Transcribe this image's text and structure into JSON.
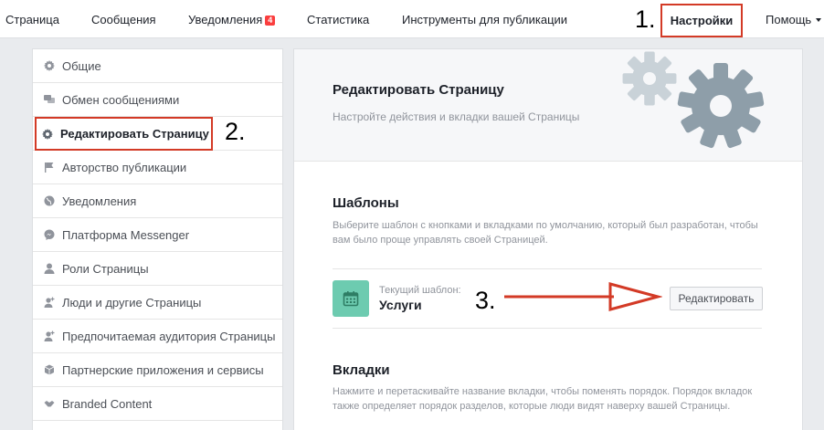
{
  "nav": {
    "page": "Страница",
    "messages": "Сообщения",
    "notifications": "Уведомления",
    "notifications_badge": "4",
    "insights": "Статистика",
    "publishing_tools": "Инструменты для публикации",
    "settings": "Настройки",
    "help": "Помощь"
  },
  "annotations": {
    "one": "1.",
    "two": "2.",
    "three": "3."
  },
  "sidebar": {
    "items": [
      {
        "label": "Общие",
        "icon": "gear-icon"
      },
      {
        "label": "Обмен сообщениями",
        "icon": "chat-icon"
      },
      {
        "label": "Редактировать Страницу",
        "icon": "gear-icon",
        "active": true
      },
      {
        "label": "Авторство публикации",
        "icon": "flag-icon"
      },
      {
        "label": "Уведомления",
        "icon": "globe-icon"
      },
      {
        "label": "Платформа Messenger",
        "icon": "messenger-icon"
      },
      {
        "label": "Роли Страницы",
        "icon": "person-icon"
      },
      {
        "label": "Люди и другие Страницы",
        "icon": "person-plus-icon"
      },
      {
        "label": "Предпочитаемая аудитория Страницы",
        "icon": "person-plus-icon"
      },
      {
        "label": "Партнерские приложения и сервисы",
        "icon": "cube-icon"
      },
      {
        "label": "Branded Content",
        "icon": "handshake-icon"
      }
    ]
  },
  "main": {
    "title": "Редактировать Страницу",
    "subtitle": "Настройте действия и вкладки вашей Страницы",
    "templates": {
      "title": "Шаблоны",
      "description": "Выберите шаблон с кнопками и вкладками по умолчанию, который был разработан, чтобы вам было проще управлять своей Страницей.",
      "current_label": "Текущий шаблон:",
      "current_value": "Услуги",
      "edit_button": "Редактировать"
    },
    "tabs": {
      "title": "Вкладки",
      "description": "Нажмите и перетаскивайте название вкладки, чтобы поменять порядок. Порядок вкладок также определяет порядок разделов, которые люди видят наверху вашей Страницы."
    }
  },
  "colors": {
    "highlight": "#d33a26",
    "template_icon": "#6dcbb0",
    "gear": "#8e9ea9",
    "badge": "#fa3e3e"
  }
}
